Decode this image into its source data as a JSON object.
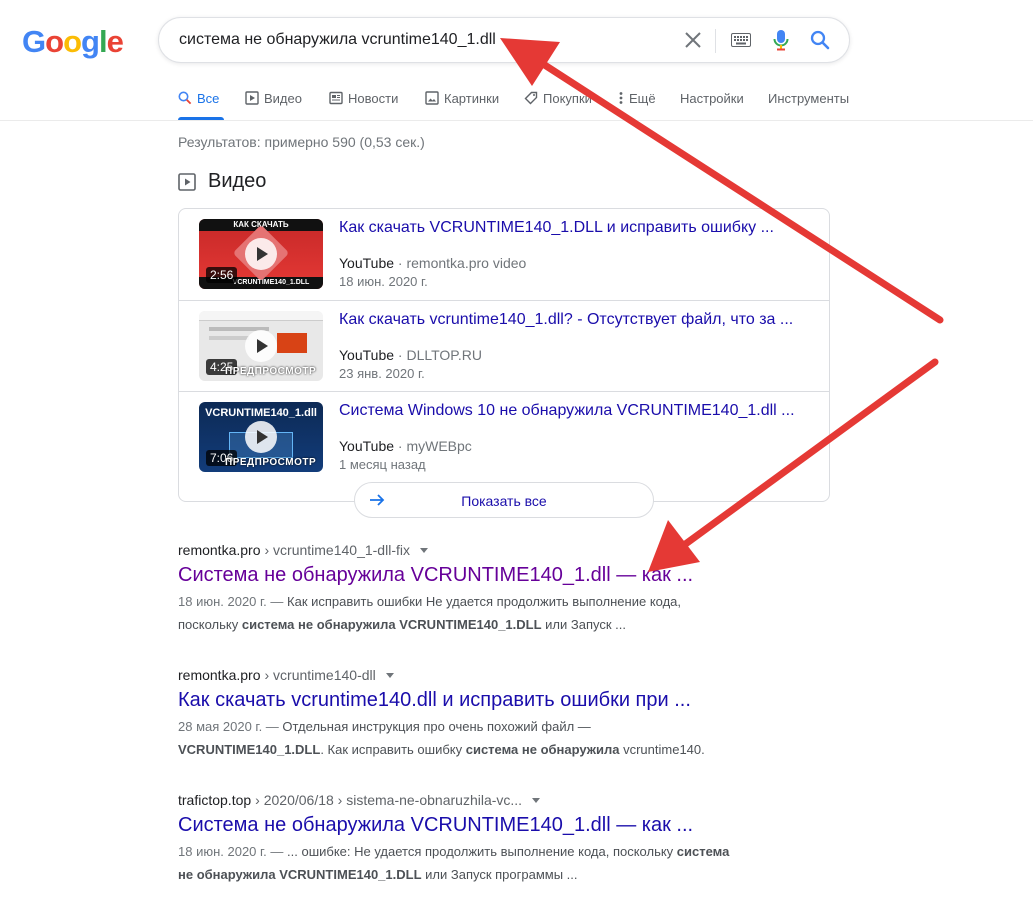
{
  "logo": {
    "letters": [
      "G",
      "o",
      "o",
      "g",
      "l",
      "e"
    ],
    "colors": [
      "#4285F4",
      "#EA4335",
      "#FBBC05",
      "#4285F4",
      "#34A853",
      "#EA4335"
    ]
  },
  "search": {
    "query": "система не обнаружила vcruntime140_1.dll"
  },
  "tabs": [
    {
      "label": "Все",
      "icon": "search-icon",
      "active": true
    },
    {
      "label": "Видео",
      "icon": "video-icon"
    },
    {
      "label": "Новости",
      "icon": "news-icon"
    },
    {
      "label": "Картинки",
      "icon": "image-icon"
    },
    {
      "label": "Покупки",
      "icon": "tag-icon"
    },
    {
      "label": "Ещё",
      "icon": "more-vert-icon"
    },
    {
      "label": "Настройки"
    },
    {
      "label": "Инструменты"
    }
  ],
  "results_stats": "Результатов: примерно 590 (0,53 сек.)",
  "videos": {
    "heading": "Видео",
    "items": [
      {
        "title": "Как скачать VCRUNTIME140_1.DLL и исправить ошибку ...",
        "platform": "YouTube",
        "channel": "remontka.pro video",
        "date": "18 июн. 2020 г.",
        "duration": "2:56",
        "thumb_top": "КАК СКАЧАТЬ",
        "thumb_bottom": "VCRUNTIME140_1.DLL",
        "preview": ""
      },
      {
        "title": "Как скачать vcruntime140_1.dll? - Отсутствует файл, что за ...",
        "platform": "YouTube",
        "channel": "DLLTOP.RU",
        "date": "23 янв. 2020 г.",
        "duration": "4:25",
        "preview": "ПРЕДПРОСМОТР"
      },
      {
        "title": "Система Windows 10 не обнаружила VCRUNTIME140_1.dll ...",
        "platform": "YouTube",
        "channel": "myWEBpc",
        "date": "1 месяц назад",
        "duration": "7:06",
        "thumb_top": "VCRUNTIME140_1.dll",
        "preview": "ПРЕДПРОСМОТР"
      }
    ],
    "show_all": "Показать все"
  },
  "results": [
    {
      "site": "remontka.pro",
      "path": "› vcruntime140_1-dll-fix",
      "title": "Система не обнаружила VCRUNTIME140_1.dll — как ...",
      "visited": true,
      "snippet_date": "18 июн. 2020 г. — ",
      "snippet_1": "Как исправить ошибки Не удается продолжить выполнение кода,",
      "snippet_2a": "поскольку ",
      "snippet_2b": "система не обнаружила VCRUNTIME140_1.DLL",
      "snippet_2c": " или Запуск ..."
    },
    {
      "site": "remontka.pro",
      "path": "› vcruntime140-dll",
      "title": "Как скачать vcruntime140.dll и исправить ошибки при ...",
      "visited": false,
      "snippet_date": "28 мая 2020 г. — ",
      "snippet_1": "Отдельная инструкция про очень похожий файл —",
      "snippet_2a": "VCRUNTIME140_1.DLL",
      "snippet_2b": ". Как исправить ошибку ",
      "snippet_2c": "система не обнаружила",
      "snippet_2d": " vcruntime140."
    },
    {
      "site": "trafictop.top",
      "path": "› 2020/06/18 › sistema-ne-obnaruzhila-vc...",
      "title": "Система не обнаружила VCRUNTIME140_1.dll — как ...",
      "visited": false,
      "snippet_date": "18 июн. 2020 г. — ",
      "snippet_1a": "... ошибке: Не удается продолжить выполнение кода, поскольку ",
      "snippet_1b": "система",
      "snippet_2a": "не обнаружила VCRUNTIME140_1.DLL",
      "snippet_2b": " или Запуск программы ..."
    }
  ],
  "annotation_color": "#e53935"
}
